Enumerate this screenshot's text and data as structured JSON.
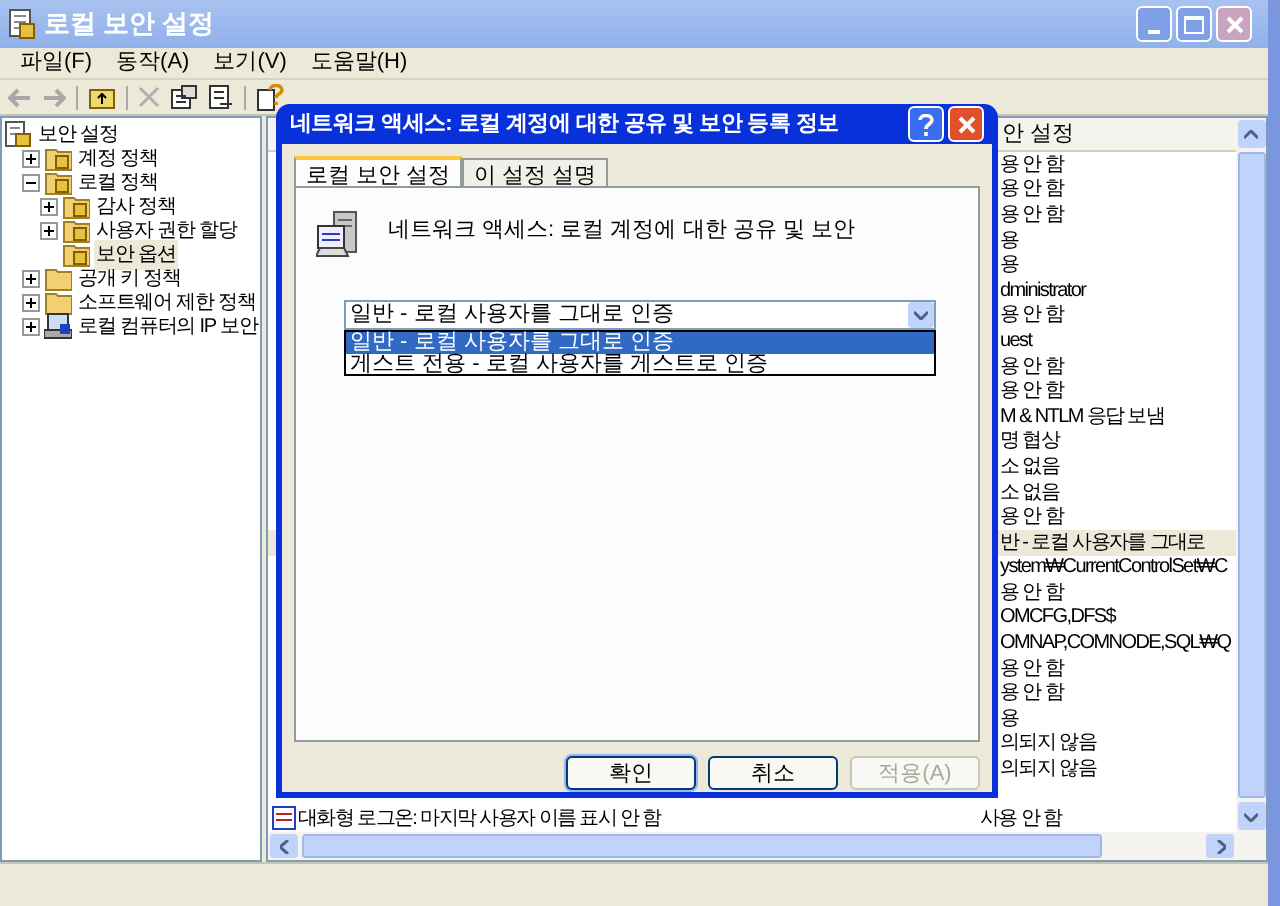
{
  "window": {
    "title": "로컬 보안 설정"
  },
  "menu": [
    "파일(F)",
    "동작(A)",
    "보기(V)",
    "도움말(H)"
  ],
  "tree": [
    {
      "label": "보안 설정",
      "kind": "root",
      "selected": false,
      "children": [
        {
          "label": "계정 정책",
          "kind": "policy-folder",
          "expanded": false,
          "selected": false
        },
        {
          "label": "로컬 정책",
          "kind": "policy-folder",
          "expanded": true,
          "selected": false,
          "children": [
            {
              "label": "감사 정책",
              "kind": "policy-folder",
              "expanded": false,
              "selected": false
            },
            {
              "label": "사용자 권한 할당",
              "kind": "policy-folder",
              "expanded": false,
              "selected": false
            },
            {
              "label": "보안 옵션",
              "kind": "policy-folder",
              "selected": true
            }
          ]
        },
        {
          "label": "공개 키 정책",
          "kind": "folder",
          "expanded": false,
          "selected": false
        },
        {
          "label": "소프트웨어 제한 정책",
          "kind": "folder",
          "expanded": false,
          "selected": false
        },
        {
          "label": "로컬 컴퓨터의 IP 보안",
          "kind": "ip-security",
          "expanded": false,
          "selected": false
        }
      ]
    }
  ],
  "list": {
    "column_header": "안 설정",
    "rows": [
      {
        "kind": "partial",
        "setting": "용 안 함",
        "selected": false
      },
      {
        "kind": "partial",
        "setting": "용 안 함",
        "selected": false
      },
      {
        "kind": "partial",
        "setting": "용 안 함",
        "selected": false
      },
      {
        "kind": "partial",
        "setting": "용",
        "selected": false
      },
      {
        "kind": "partial",
        "setting": "용",
        "selected": false
      },
      {
        "kind": "partial",
        "setting": "dministrator",
        "selected": false
      },
      {
        "kind": "partial",
        "setting": "용 안 함",
        "selected": false
      },
      {
        "kind": "partial",
        "setting": "uest",
        "selected": false
      },
      {
        "kind": "partial",
        "setting": "용 안 함",
        "selected": false
      },
      {
        "kind": "partial",
        "setting": "용 안 함",
        "selected": false
      },
      {
        "kind": "partial",
        "setting": "M & NTLM 응답 보냄",
        "selected": false
      },
      {
        "kind": "partial",
        "setting": "명 협상",
        "selected": false
      },
      {
        "kind": "partial",
        "setting": "소 없음",
        "selected": false
      },
      {
        "kind": "partial",
        "setting": "소 없음",
        "selected": false
      },
      {
        "kind": "partial",
        "setting": "용 안 함",
        "selected": false
      },
      {
        "kind": "partial",
        "setting": "반 - 로컬 사용자를 그대로",
        "selected": true
      },
      {
        "kind": "partial",
        "setting": "ystem₩CurrentControlSet₩C",
        "selected": false
      },
      {
        "kind": "partial",
        "setting": "용 안 함",
        "selected": false
      },
      {
        "kind": "partial",
        "setting": "OMCFG,DFS$",
        "selected": false
      },
      {
        "kind": "partial",
        "setting": "OMNAP,COMNODE,SQL₩Q",
        "selected": false
      },
      {
        "kind": "partial",
        "setting": "용 안 함",
        "selected": false
      },
      {
        "kind": "partial",
        "setting": "용 안 함",
        "selected": false
      },
      {
        "kind": "partial",
        "setting": "용",
        "selected": false
      },
      {
        "kind": "partial",
        "setting": "의되지 않음",
        "selected": false
      },
      {
        "kind": "partial",
        "setting": "의되지 않음",
        "selected": false
      },
      {
        "kind": "full",
        "policy": "대화형 로그온: 마지막 사용자 이름 표시 안 함",
        "setting": "사용 안 함",
        "selected": false
      }
    ]
  },
  "dialog": {
    "title": "네트워크 액세스: 로컬 계정에 대한 공유 및 보안 등록 정보",
    "tabs": [
      {
        "label": "로컬 보안 설정",
        "selected": true
      },
      {
        "label": "이 설정 설명",
        "selected": false
      }
    ],
    "policy_name": "네트워크 액세스: 로컬 계정에 대한 공유 및 보안",
    "dropdown": {
      "value": "일반 - 로컬 사용자를 그대로 인증",
      "expanded": true,
      "options": [
        {
          "label": "일반 - 로컬 사용자를 그대로 인증",
          "selected": true
        },
        {
          "label": "게스트 전용 - 로컬 사용자를 게스트로 인증",
          "selected": false
        }
      ]
    },
    "buttons": [
      {
        "label": "확인",
        "disabled": false,
        "default": true
      },
      {
        "label": "취소",
        "disabled": false,
        "default": false
      },
      {
        "label": "적용(A)",
        "disabled": true,
        "default": false
      }
    ]
  }
}
